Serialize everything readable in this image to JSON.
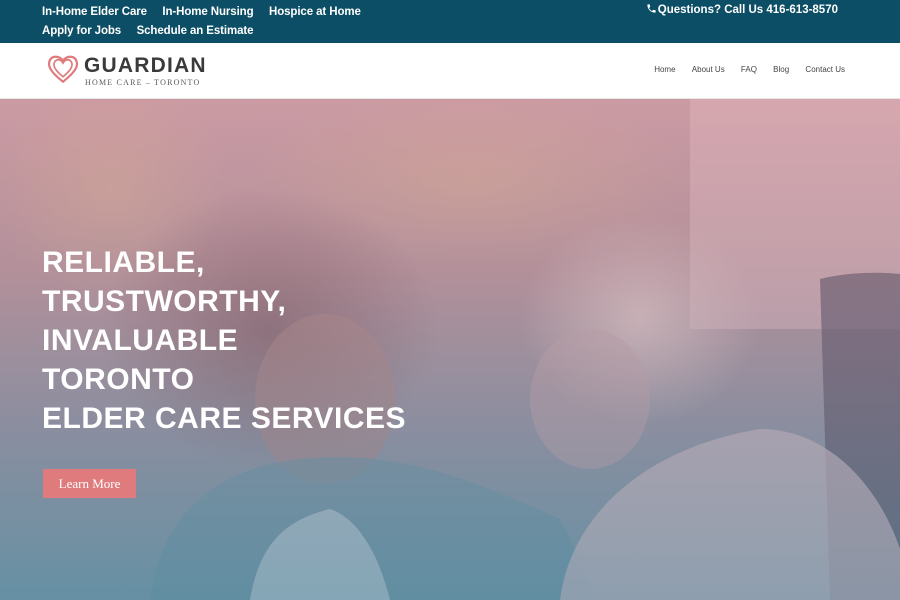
{
  "topbar": {
    "links": [
      "In-Home Elder Care",
      "In-Home Nursing",
      "Hospice at Home",
      "Apply for Jobs",
      "Schedule an Estimate"
    ],
    "phone": "Questions? Call Us 416-613-8570"
  },
  "logo": {
    "brand": "GUARDIAN",
    "tagline": "HOME CARE – TORONTO"
  },
  "nav": [
    "Home",
    "About Us",
    "FAQ",
    "Blog",
    "Contact Us"
  ],
  "hero": {
    "title_lines": [
      "RELIABLE,",
      "TRUSTWORTHY,",
      "INVALUABLE",
      "TORONTO",
      "ELDER CARE SERVICES"
    ],
    "cta_label": "Learn More"
  },
  "colors": {
    "topbar_bg": "#0c4e65",
    "cta_bg": "#e07b7d",
    "logo_heart": "#e07b7d"
  },
  "icons": [
    "phone-icon",
    "heart-logo-icon"
  ]
}
